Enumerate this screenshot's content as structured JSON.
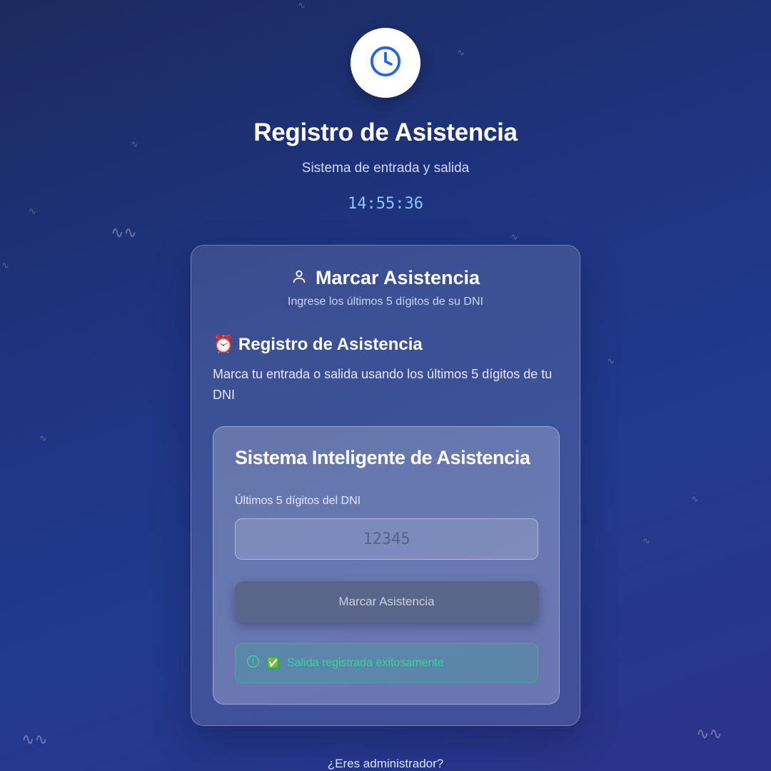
{
  "header": {
    "clock_icon": "clock-icon",
    "title": "Registro de Asistencia",
    "subtitle": "Sistema de entrada y salida",
    "time": "14:55:36"
  },
  "card": {
    "user_icon": "user-icon",
    "title": "Marcar Asistencia",
    "subtitle": "Ingrese los últimos 5 dígitos de su DNI",
    "section_emoji": "⏰",
    "section_title": "Registro de Asistencia",
    "section_description": "Marca tu entrada o salida usando los últimos 5 dígitos de tu DNI",
    "form": {
      "title": "Sistema Inteligente de Asistencia",
      "dni_label": "Últimos 5 dígitos del DNI",
      "dni_value": "",
      "dni_placeholder": "12345",
      "submit_label": "Marcar Asistencia",
      "alert_icon": "alert-circle-icon",
      "alert_emoji": "✅",
      "alert_text": "Salida registrada exitosamente"
    }
  },
  "footer": {
    "admin_link": "¿Eres administrador?"
  },
  "colors": {
    "background_top": "#1c2a5e",
    "background_bottom": "#2c338a",
    "clock_blue": "#2563eb",
    "time_text": "#8fc3ff",
    "success_text": "#34d399",
    "button_bg": "#5a6689"
  }
}
